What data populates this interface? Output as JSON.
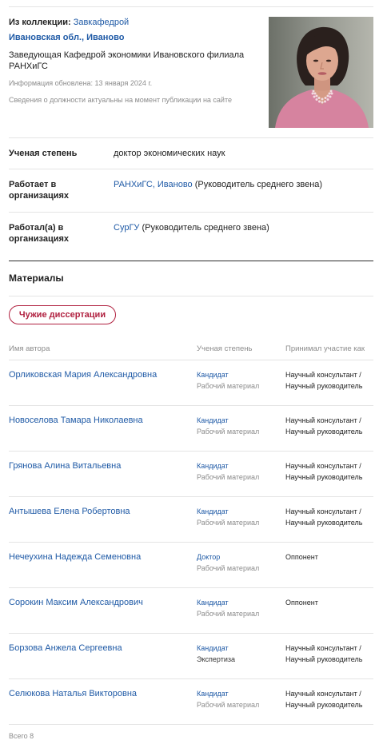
{
  "colors": {
    "text": "#222222",
    "link": "#1f5aa6",
    "muted": "#8c8c8c",
    "accent": "#b0203f",
    "divider": "#e4e4e4",
    "divider_strong": "#2a2a2a"
  },
  "profile": {
    "collection_label": "Из коллекции:",
    "collection_value": "Завкафедрой",
    "location": "Ивановская обл., Иваново",
    "position": "Заведующая Кафедрой экономики Ивановского филиала РАНХиГС",
    "updated": "Информация обновлена: 13 января 2024 г.",
    "note": "Сведения о должности актуальны на момент публикации на сайте"
  },
  "details": [
    {
      "label": "Ученая степень",
      "value": "доктор экономических наук"
    },
    {
      "label": "Работает в организациях",
      "org": "РАНХиГС, Иваново",
      "role": "(Руководитель среднего звена)"
    },
    {
      "label": "Работал(а) в организациях",
      "org": "СурГУ",
      "role": "(Руководитель среднего звена)"
    }
  ],
  "materials": {
    "title": "Материалы",
    "filter_button": "Чужие диссертации",
    "columns": {
      "author": "Имя автора",
      "degree": "Ученая степень",
      "participation": "Принимал участие как"
    },
    "rows": [
      {
        "author": "Орликовская Мария Александровна",
        "degree": "Кандидат",
        "material": "Рабочий материал",
        "participation": "Научный консультант / Научный руководитель"
      },
      {
        "author": "Новоселова Тамара Николаевна",
        "degree": "Кандидат",
        "material": "Рабочий материал",
        "participation": "Научный консультант / Научный руководитель"
      },
      {
        "author": "Грянова Алина Витальевна",
        "degree": "Кандидат",
        "material": "Рабочий материал",
        "participation": "Научный консультант / Научный руководитель"
      },
      {
        "author": "Антышева Елена Робертовна",
        "degree": "Кандидат",
        "material": "Рабочий материал",
        "participation": "Научный консультант / Научный руководитель"
      },
      {
        "author": "Нечеухина Надежда Семеновна",
        "degree": "Доктор",
        "material": "Рабочий материал",
        "participation": "Оппонент"
      },
      {
        "author": "Сорокин Максим Александрович",
        "degree": "Кандидат",
        "material": "Рабочий материал",
        "participation": "Оппонент"
      },
      {
        "author": "Борзова Анжела Сергеевна",
        "degree": "Кандидат",
        "material": "Экспертиза",
        "participation": "Научный консультант / Научный руководитель"
      },
      {
        "author": "Селюкова Наталья Викторовна",
        "degree": "Кандидат",
        "material": "Рабочий материал",
        "participation": "Научный консультант / Научный руководитель"
      }
    ],
    "total": "Всего 8"
  }
}
